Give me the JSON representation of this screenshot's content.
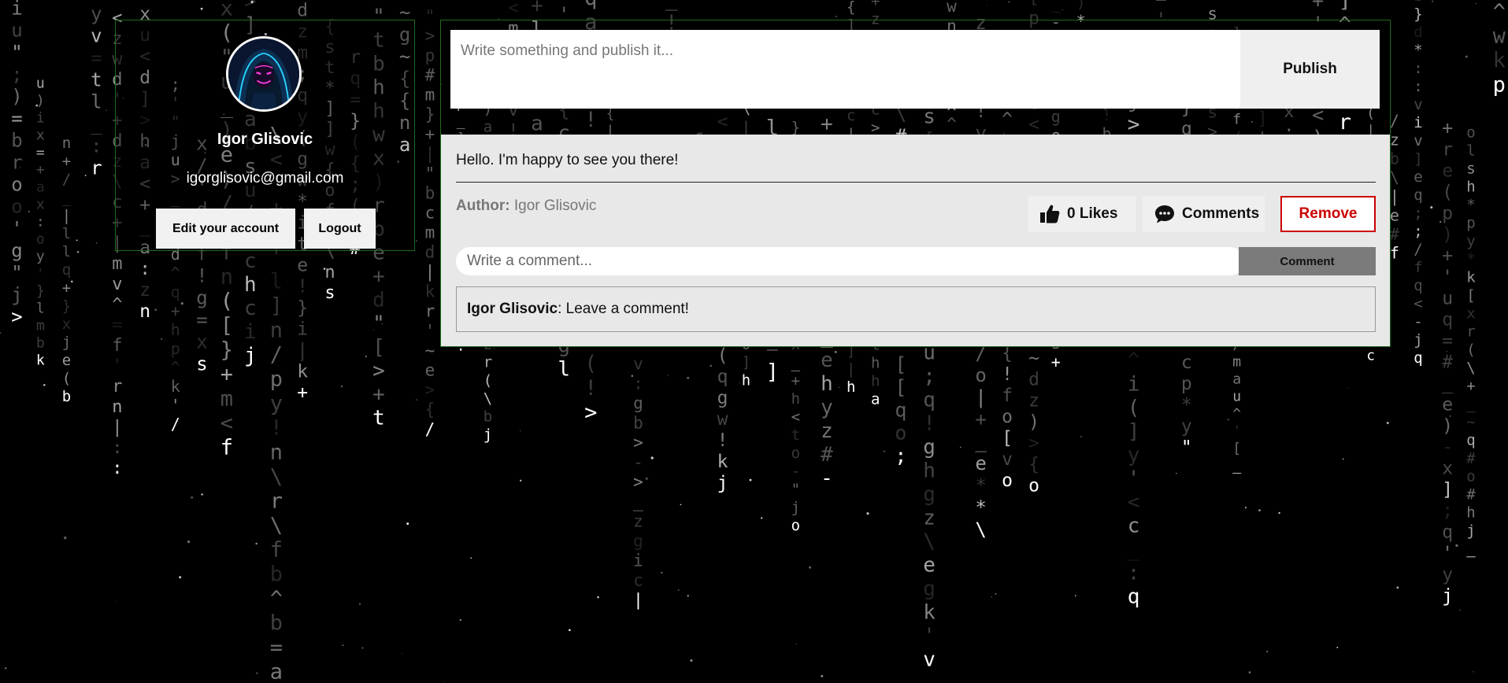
{
  "profile": {
    "name": "Igor Glisovic",
    "email": "igorglisovic@gmail.com",
    "edit_label": "Edit your account",
    "logout_label": "Logout",
    "avatar_icon": "hooded-neon-mask-avatar"
  },
  "composer": {
    "placeholder": "Write something and publish it...",
    "publish_label": "Publish"
  },
  "post": {
    "text": "Hello. I'm happy to see you there!",
    "author_label": "Author:",
    "author_name": "Igor Glisovic",
    "likes_label": "0 Likes",
    "likes_icon": "thumbs-up-icon",
    "comments_label": "Comments",
    "comments_icon": "speech-bubble-icon",
    "remove_label": "Remove",
    "comment_placeholder": "Write a comment...",
    "comment_button_label": "Comment",
    "comments": [
      {
        "author": "Igor Glisovic",
        "separator": ":",
        "text": " Leave a comment!"
      }
    ]
  },
  "colors": {
    "background": "#000000",
    "panel_border": "#1d6b1d",
    "post_background": "#e8e8e8",
    "remove_accent": "#cc0000",
    "comment_button": "#7b7b7b"
  }
}
